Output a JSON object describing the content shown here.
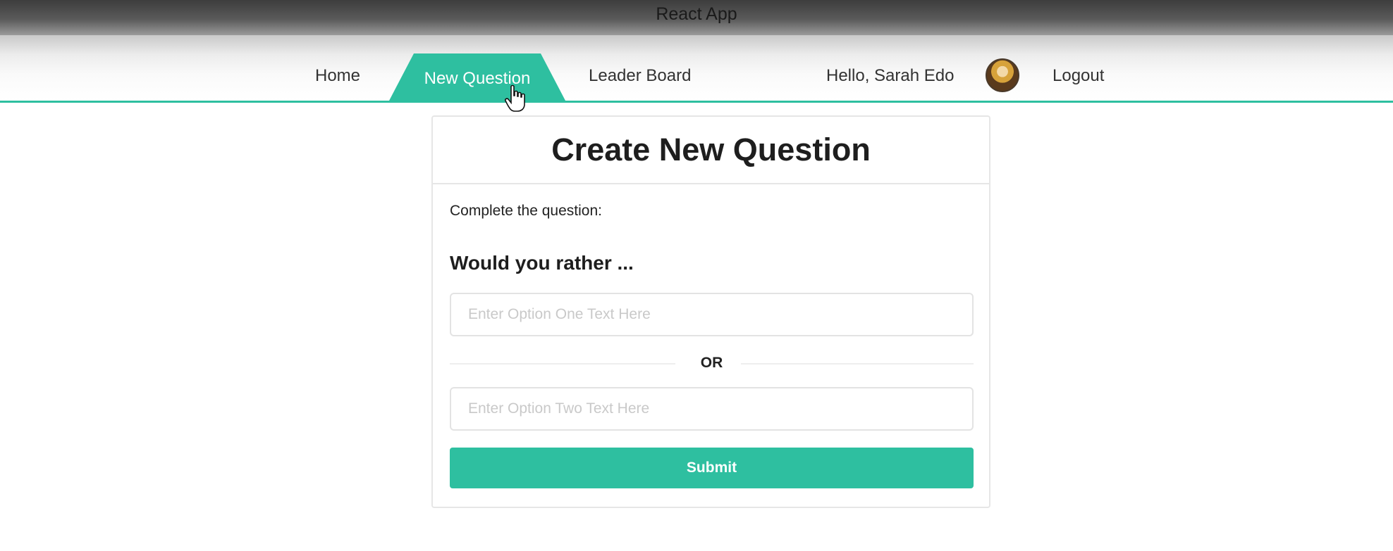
{
  "window": {
    "title": "React App"
  },
  "nav": {
    "home": "Home",
    "new_question": "New Question",
    "leader_board": "Leader Board",
    "greeting": "Hello, Sarah Edo",
    "logout": "Logout",
    "accent_color": "#2ebfa0"
  },
  "form": {
    "title": "Create New Question",
    "instruction": "Complete the question:",
    "prompt": "Would you rather ...",
    "option_one": {
      "value": "",
      "placeholder": "Enter Option One Text Here"
    },
    "divider": "OR",
    "option_two": {
      "value": "",
      "placeholder": "Enter Option Two Text Here"
    },
    "submit": "Submit"
  }
}
